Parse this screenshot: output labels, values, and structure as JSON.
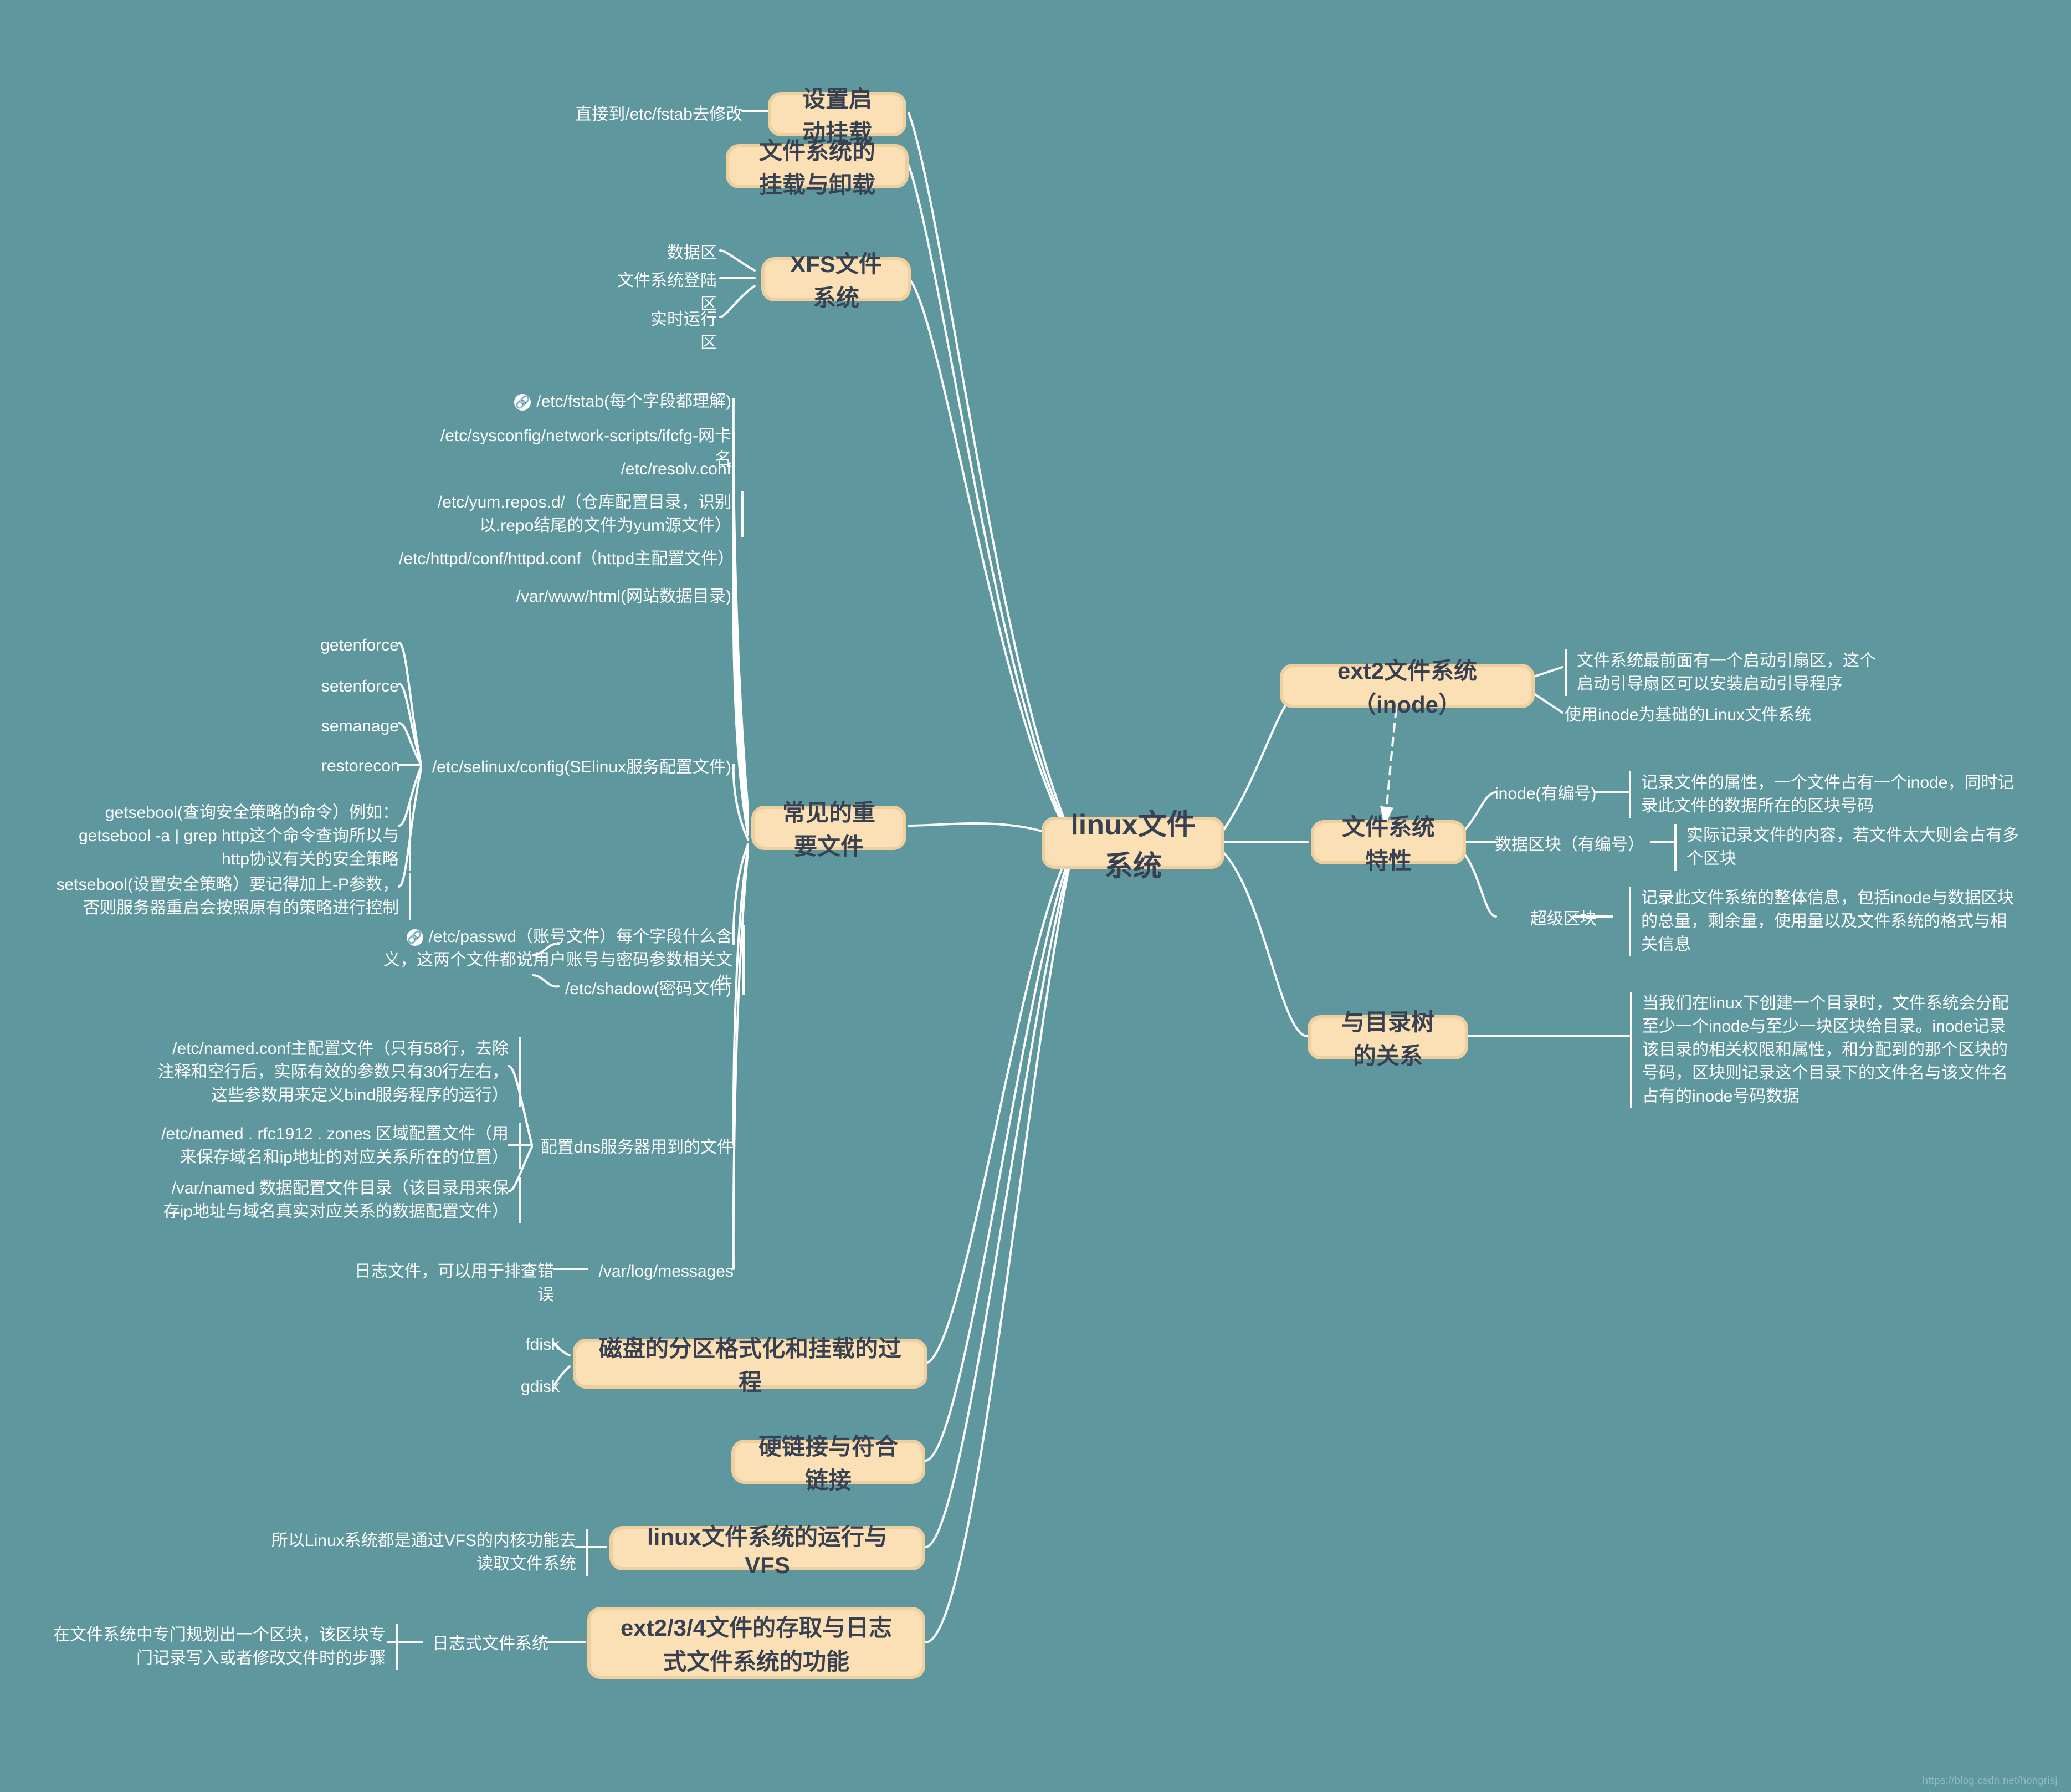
{
  "root": {
    "label": "linux文件系统"
  },
  "left": {
    "boot_mount": {
      "label": "设置启动挂载",
      "note": "直接到/etc/fstab去修改"
    },
    "mount_ops": {
      "label": "文件系统的挂载与卸载"
    },
    "xfs": {
      "label": "XFS文件系统",
      "children": [
        "数据区",
        "文件系统登陆区",
        "实时运行区"
      ]
    },
    "important": {
      "label": "常见的重要文件",
      "files": [
        "/etc/fstab(每个字段都理解)",
        "/etc/sysconfig/network-scripts/ifcfg-网卡名",
        "/etc/resolv.conf",
        "/etc/yum.repos.d/（仓库配置目录，识别以.repo结尾的文件为yum源文件）",
        "/etc/httpd/conf/httpd.conf（httpd主配置文件）",
        "/var/www/html(网站数据目录)"
      ],
      "selinux": {
        "label": "/etc/selinux/config(SElinux服务配置文件)",
        "cmds": [
          "getenforce",
          "setenforce",
          "semanage",
          "restorecon"
        ],
        "getsebool": "getsebool(查询安全策略的命令）例如：getsebool -a | grep http这个命令查询所以与http协议有关的安全策略",
        "setsebool": "setsebool(设置安全策略）要记得加上-P参数，否则服务器重启会按照原有的策略进行控制"
      },
      "passwd": {
        "line1": "/etc/passwd（账号文件）每个字段什么含义，这两个文件都说用户账号与密码参数相关文件",
        "line2": "/etc/shadow(密码文件)"
      },
      "dns": {
        "label": "配置dns服务器用到的文件",
        "items": [
          "/etc/named.conf主配置文件（只有58行，去除注释和空行后，实际有效的参数只有30行左右，这些参数用来定义bind服务程序的运行）",
          "/etc/named . rfc1912 . zones 区域配置文件（用来保存域名和ip地址的对应关系所在的位置）",
          "/var/named  数据配置文件目录（该目录用来保存ip地址与域名真实对应关系的数据配置文件）"
        ]
      },
      "log": {
        "path": "/var/log/messages",
        "desc": "日志文件，可以用于排查错误"
      }
    },
    "partition": {
      "label": "磁盘的分区格式化和挂载的过程",
      "tools": [
        "fdisk",
        "gdisk"
      ]
    },
    "links": {
      "label": "硬链接与符合链接"
    },
    "vfs": {
      "label": "linux文件系统的运行与VFS",
      "note": "所以Linux系统都是通过VFS的内核功能去读取文件系统"
    },
    "journal": {
      "label": "ext2/3/4文件的存取与日志式文件系统的功能",
      "mid": "日志式文件系统",
      "note": "在文件系统中专门规划出一个区块，该区块专门记录写入或者修改文件时的步骤"
    }
  },
  "right": {
    "ext2": {
      "label": "ext2文件系统（inode）",
      "notes": [
        "文件系统最前面有一个启动引扇区，这个启动引导扇区可以安装启动引导程序",
        "使用inode为基础的Linux文件系统"
      ]
    },
    "traits": {
      "label": "文件系统特性",
      "inode": {
        "name": "inode(有编号)",
        "desc": "记录文件的属性，一个文件占有一个inode，同时记录此文件的数据所在的区块号码"
      },
      "block": {
        "name": "数据区块（有编号）",
        "desc": "实际记录文件的内容，若文件太大则会占有多个区块"
      },
      "super": {
        "name": "超级区块",
        "desc": "记录此文件系统的整体信息，包括inode与数据区块的总量，剩余量，使用量以及文件系统的格式与相关信息"
      }
    },
    "tree": {
      "label": "与目录树的关系",
      "desc": "当我们在linux下创建一个目录时，文件系统会分配至少一个inode与至少一块区块给目录。inode记录该目录的相关权限和属性，和分配到的那个区块的号码，区块则记录这个目录下的文件名与该文件名占有的inode号码数据"
    }
  },
  "watermark": "https://blog.csdn.net/hongrisj"
}
